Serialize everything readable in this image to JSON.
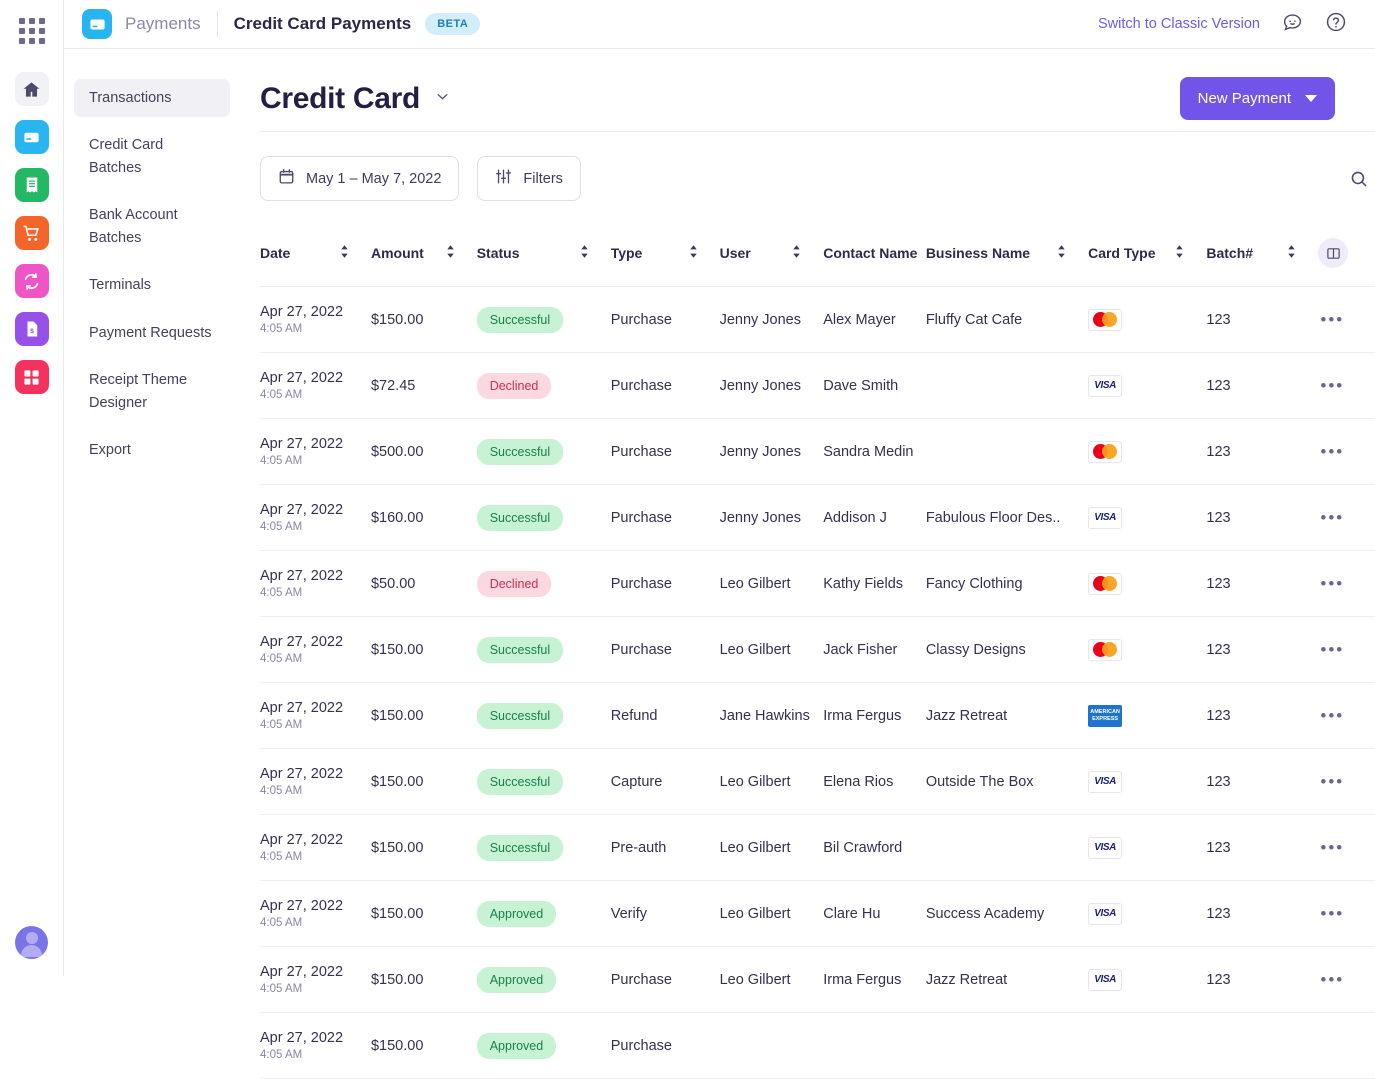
{
  "rail": {
    "launcher": "app-launcher",
    "icons": [
      {
        "name": "home-icon",
        "color": "#f1f2f5"
      },
      {
        "name": "payments-card-icon",
        "color": "#29b6f0"
      },
      {
        "name": "receipt-icon",
        "color": "#24b864"
      },
      {
        "name": "shopping-cart-icon",
        "color": "#f4652a"
      },
      {
        "name": "recurring-sync-icon",
        "color": "#ef55c6"
      },
      {
        "name": "invoice-icon",
        "color": "#9750e8"
      },
      {
        "name": "dashboard-grid-icon",
        "color": "#f5315e"
      }
    ]
  },
  "topbar": {
    "app_name": "Payments",
    "page_name": "Credit Card Payments",
    "beta_badge": "BETA",
    "switch_classic": "Switch to Classic Version",
    "feedback_icon": "chat-feedback-icon",
    "help_icon": "help-circle-icon"
  },
  "subnav": {
    "items": [
      {
        "label": "Transactions",
        "active": true
      },
      {
        "label": "Credit Card Batches",
        "active": false
      },
      {
        "label": "Bank Account Batches",
        "active": false
      },
      {
        "label": "Terminals",
        "active": false
      },
      {
        "label": "Payment Requests",
        "active": false
      },
      {
        "label": "Receipt Theme Designer",
        "active": false
      },
      {
        "label": "Export",
        "active": false
      }
    ]
  },
  "main": {
    "title": "Credit Card",
    "title_caret": "chevron-down-icon",
    "new_payment_label": "New Payment",
    "date_range": "May 1 – May 7, 2022",
    "filters_label": "Filters",
    "search_icon": "search-icon",
    "column_toggle_icon": "column-layout-icon"
  },
  "table": {
    "columns": [
      {
        "key": "date",
        "label": "Date",
        "sortable": true
      },
      {
        "key": "amount",
        "label": "Amount",
        "sortable": true
      },
      {
        "key": "status",
        "label": "Status",
        "sortable": true
      },
      {
        "key": "type",
        "label": "Type",
        "sortable": true
      },
      {
        "key": "user",
        "label": "User",
        "sortable": true
      },
      {
        "key": "contact",
        "label": "Contact Name",
        "sortable": false
      },
      {
        "key": "business",
        "label": "Business Name",
        "sortable": true
      },
      {
        "key": "card",
        "label": "Card Type",
        "sortable": true
      },
      {
        "key": "batch",
        "label": "Batch#",
        "sortable": true
      }
    ],
    "rows": [
      {
        "date": "Apr 27, 2022",
        "time": "4:05 AM",
        "amount": "$150.00",
        "status": "Successful",
        "type": "Purchase",
        "user": "Jenny Jones",
        "contact": "Alex Mayer",
        "business": "Fluffy Cat Cafe",
        "card": "mastercard",
        "batch": "123"
      },
      {
        "date": "Apr 27, 2022",
        "time": "4:05 AM",
        "amount": "$72.45",
        "status": "Declined",
        "type": "Purchase",
        "user": "Jenny Jones",
        "contact": "Dave Smith",
        "business": "",
        "card": "visa",
        "batch": "123"
      },
      {
        "date": "Apr 27, 2022",
        "time": "4:05 AM",
        "amount": "$500.00",
        "status": "Successful",
        "type": "Purchase",
        "user": "Jenny Jones",
        "contact": "Sandra Medin",
        "business": "",
        "card": "mastercard",
        "batch": "123"
      },
      {
        "date": "Apr 27, 2022",
        "time": "4:05 AM",
        "amount": "$160.00",
        "status": "Successful",
        "type": "Purchase",
        "user": "Jenny Jones",
        "contact": "Addison J",
        "business": "Fabulous Floor Des..",
        "card": "visa",
        "batch": "123"
      },
      {
        "date": "Apr 27, 2022",
        "time": "4:05 AM",
        "amount": "$50.00",
        "status": "Declined",
        "type": "Purchase",
        "user": "Leo Gilbert",
        "contact": "Kathy Fields",
        "business": "Fancy Clothing",
        "card": "mastercard",
        "batch": "123"
      },
      {
        "date": "Apr 27, 2022",
        "time": "4:05 AM",
        "amount": "$150.00",
        "status": "Successful",
        "type": "Purchase",
        "user": "Leo Gilbert",
        "contact": "Jack Fisher",
        "business": "Classy Designs",
        "card": "mastercard",
        "batch": "123"
      },
      {
        "date": "Apr 27, 2022",
        "time": "4:05 AM",
        "amount": "$150.00",
        "status": "Successful",
        "type": "Refund",
        "user": "Jane Hawkins",
        "contact": "Irma Fergus",
        "business": "Jazz Retreat",
        "card": "amex",
        "batch": "123"
      },
      {
        "date": "Apr 27, 2022",
        "time": "4:05 AM",
        "amount": "$150.00",
        "status": "Successful",
        "type": "Capture",
        "user": "Leo Gilbert",
        "contact": "Elena Rios",
        "business": "Outside The Box",
        "card": "visa",
        "batch": "123"
      },
      {
        "date": "Apr 27, 2022",
        "time": "4:05 AM",
        "amount": "$150.00",
        "status": "Successful",
        "type": "Pre-auth",
        "user": "Leo Gilbert",
        "contact": "Bil Crawford",
        "business": "",
        "card": "visa",
        "batch": "123"
      },
      {
        "date": "Apr 27, 2022",
        "time": "4:05 AM",
        "amount": "$150.00",
        "status": "Approved",
        "type": "Verify",
        "user": "Leo Gilbert",
        "contact": "Clare Hu",
        "business": "Success Academy",
        "card": "visa",
        "batch": "123"
      },
      {
        "date": "Apr 27, 2022",
        "time": "4:05 AM",
        "amount": "$150.00",
        "status": "Approved",
        "type": "Purchase",
        "user": "Leo Gilbert",
        "contact": "Irma Fergus",
        "business": "Jazz Retreat",
        "card": "visa",
        "batch": "123"
      },
      {
        "date": "Apr 27, 2022",
        "time": "4:05 AM",
        "amount": "$150.00",
        "status": "Approved",
        "type": "Purchase",
        "user": "",
        "contact": "",
        "business": "",
        "card": "",
        "batch": ""
      }
    ],
    "row_menu_icon": "more-options-icon"
  },
  "colors": {
    "accent": "#7254e8",
    "link": "#6b5ce7",
    "success_bg": "#c8f2d4",
    "success_text": "#17824a",
    "declined_bg": "#fcd9e0",
    "declined_text": "#d52b52",
    "beta_bg": "#d4edfb",
    "beta_text": "#1c7fb5"
  }
}
